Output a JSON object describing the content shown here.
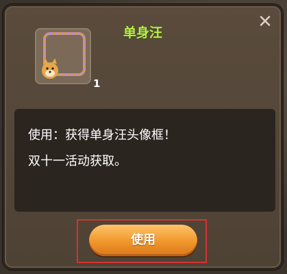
{
  "dialog": {
    "title": "单身汪",
    "close_icon": "close-icon",
    "item": {
      "icon": "doge-avatar-frame-icon",
      "count": "1"
    },
    "description": {
      "line1": "使用：获得单身汪头像框！",
      "line2": "双十一活动获取。"
    },
    "use_button_label": "使用",
    "colors": {
      "title": "#b8f04a",
      "button": "#f0962a",
      "highlight_frame": "#d93030"
    }
  }
}
